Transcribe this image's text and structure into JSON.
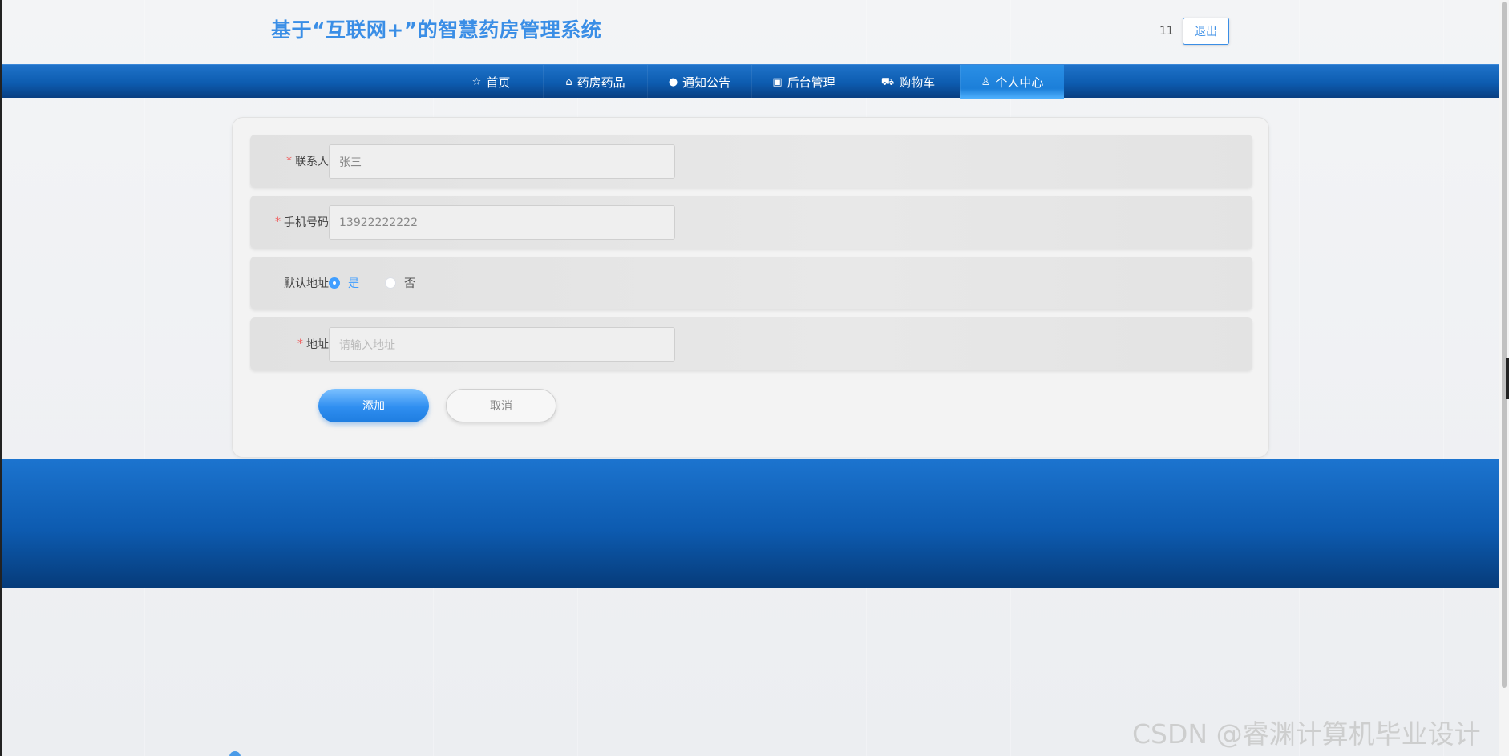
{
  "header": {
    "site_title": "基于“互联网+”的智慧药房管理系统",
    "user_name": "11",
    "logout_label": "退出"
  },
  "nav": {
    "items": [
      {
        "label": "首页",
        "icon": "star-icon",
        "active": false
      },
      {
        "label": "药房药品",
        "icon": "bag-icon",
        "active": false
      },
      {
        "label": "通知公告",
        "icon": "alert-icon",
        "active": false
      },
      {
        "label": "后台管理",
        "icon": "box-icon",
        "active": false
      },
      {
        "label": "购物车",
        "icon": "cart-icon",
        "active": false
      },
      {
        "label": "个人中心",
        "icon": "user-icon",
        "active": true
      }
    ]
  },
  "form": {
    "contact": {
      "label": "联系人",
      "required": true,
      "value": "张三"
    },
    "phone": {
      "label": "手机号码",
      "required": true,
      "value": "13922222222"
    },
    "default_address": {
      "label": "默认地址",
      "options": [
        "是",
        "否"
      ],
      "selected": "是"
    },
    "address": {
      "label": "地址",
      "required": true,
      "placeholder": "请输入地址"
    },
    "submit_label": "添加",
    "cancel_label": "取消"
  },
  "watermark": "CSDN @睿渊计算机毕业设计",
  "colors": {
    "primary": "#409eff",
    "nav_bg": "#0d5cb0",
    "title": "#3a8ee6",
    "required": "#f05b5b"
  }
}
